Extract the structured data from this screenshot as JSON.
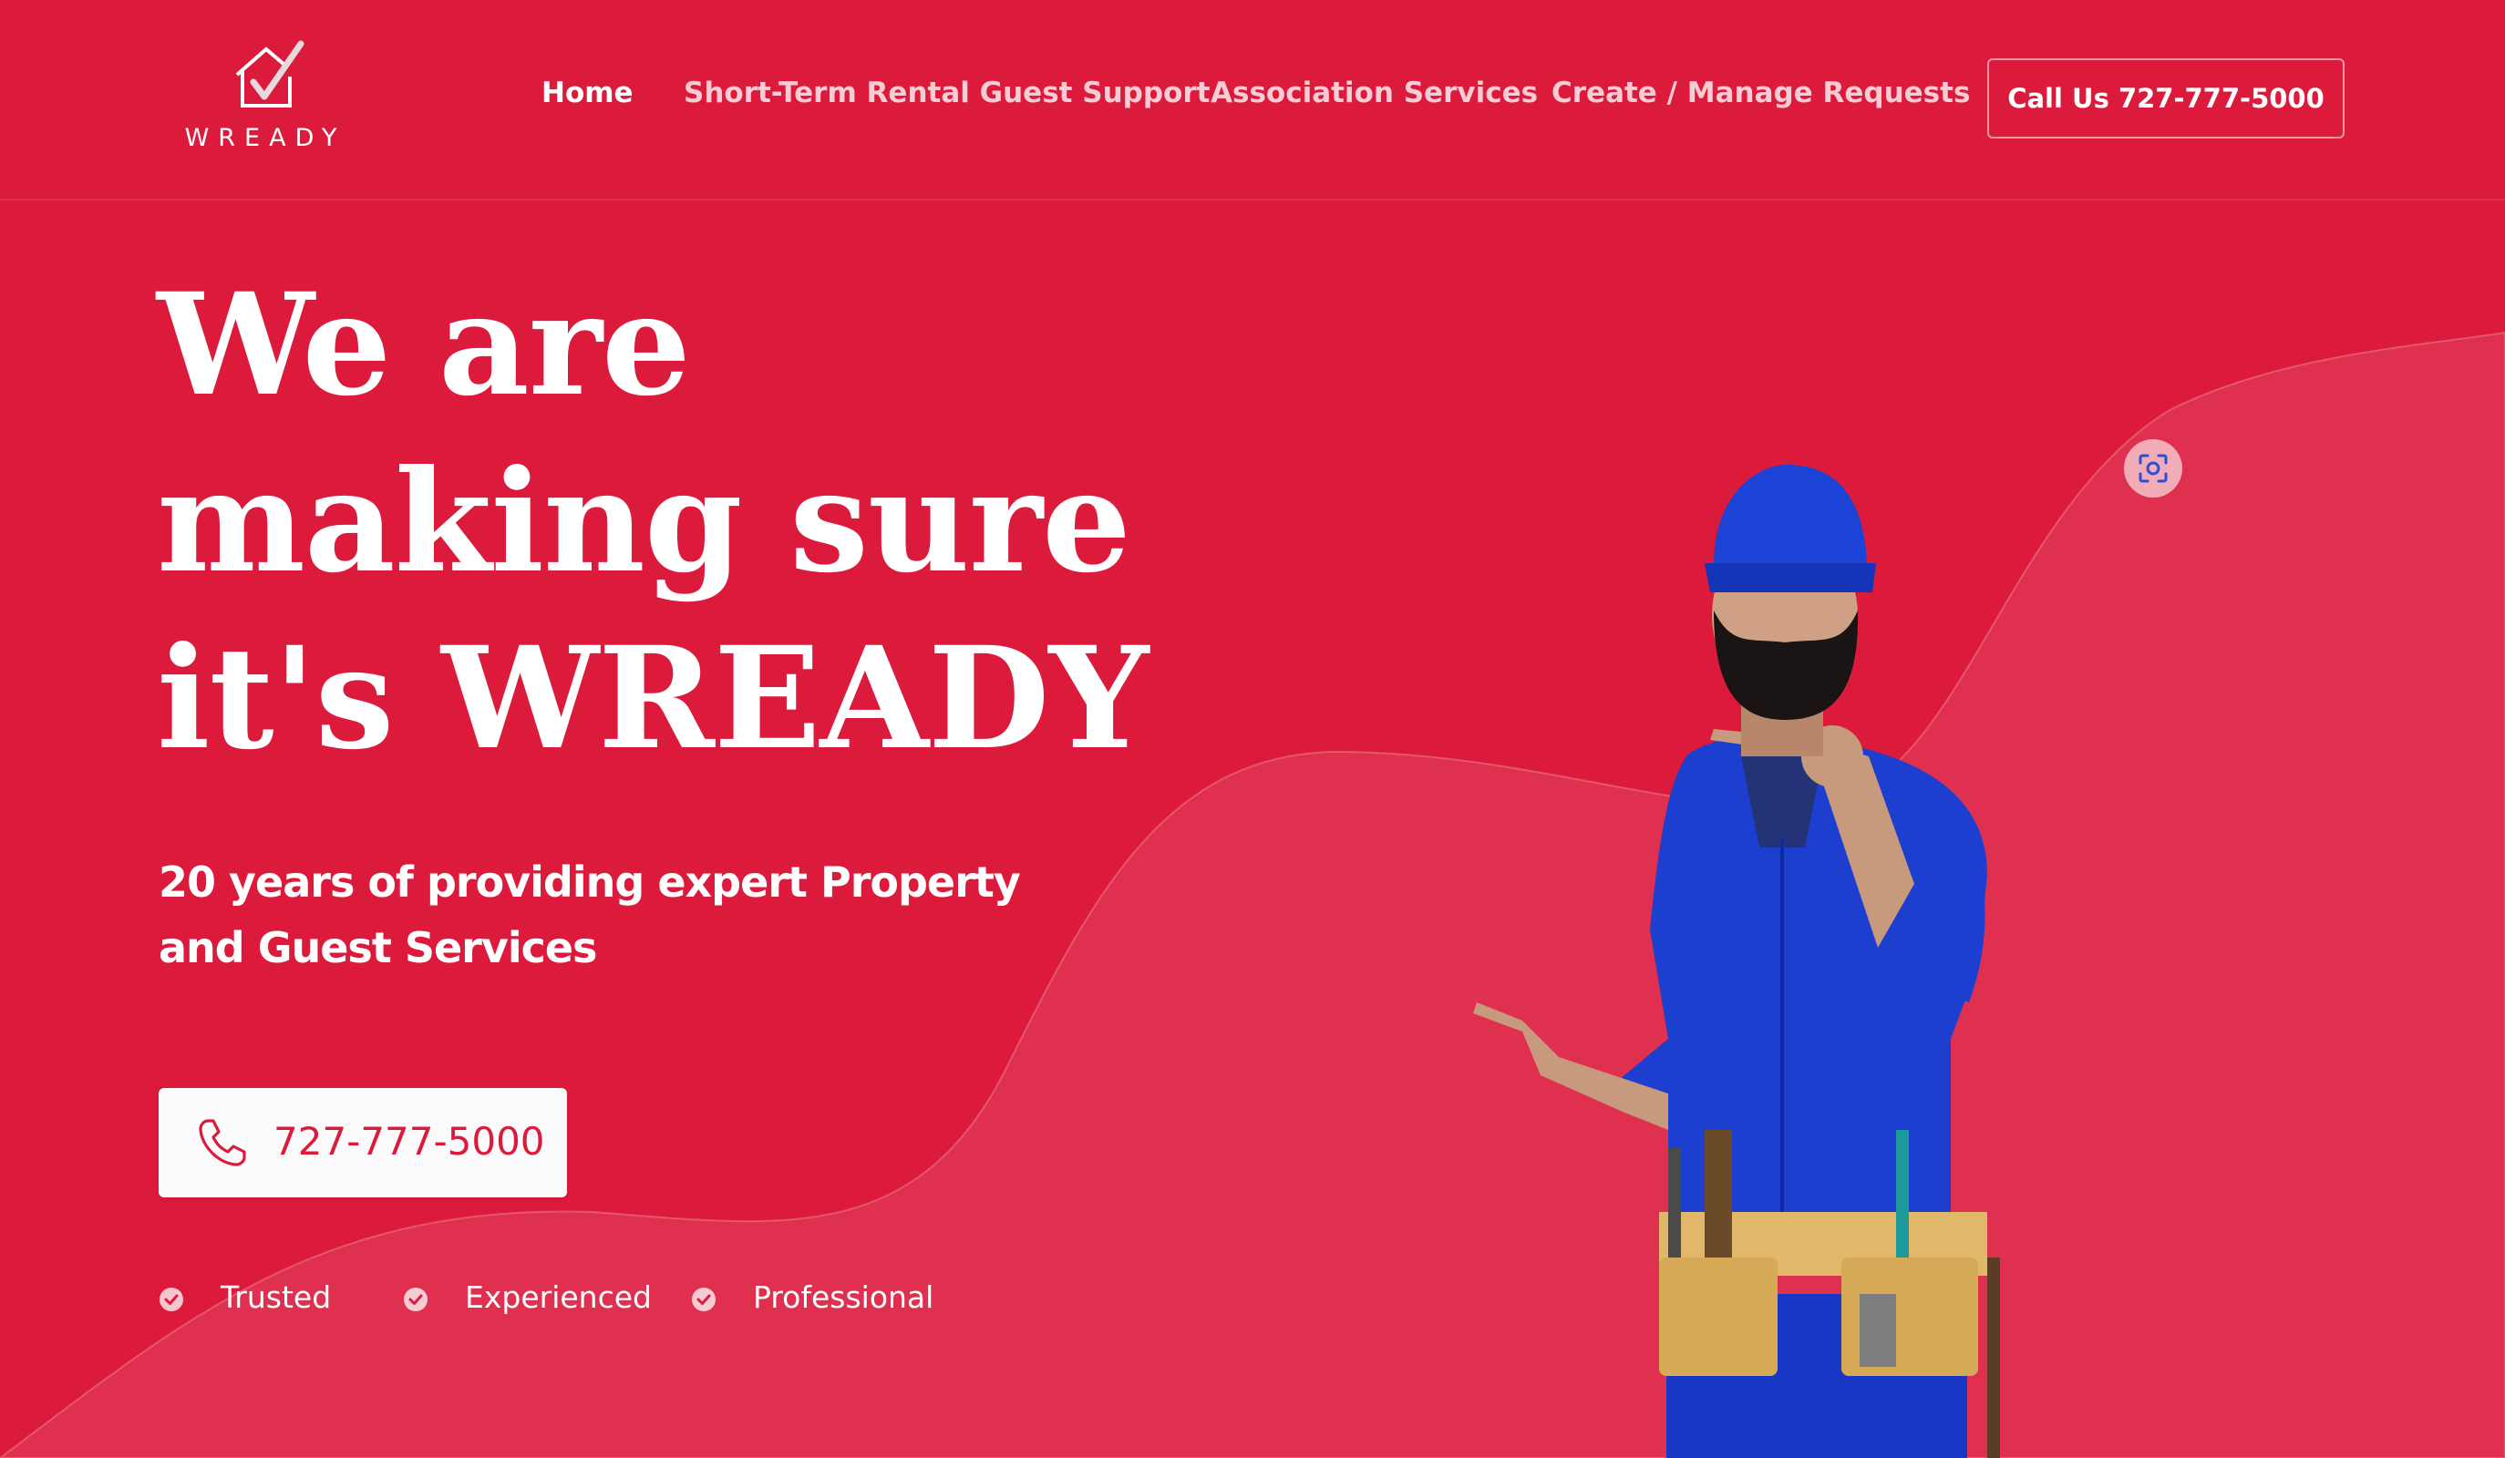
{
  "brand": {
    "name": "WREADY",
    "primary_color": "#dc1a3b",
    "text_color": "#ffffff"
  },
  "header": {
    "logo_icon": "house-check-icon",
    "nav": [
      {
        "label": "Home",
        "active": true
      },
      {
        "label": "Short-Term Rental Guest Support",
        "active": false
      },
      {
        "label": "Association Services",
        "active": false
      },
      {
        "label": "Create / Manage Requests",
        "active": false
      }
    ],
    "cta_label": "Call Us 727-777-5000"
  },
  "hero": {
    "title_lines": [
      "We are",
      "making sure",
      "it's WREADY"
    ],
    "subtitle_lines": [
      "20 years of providing expert Property",
      "and Guest Services"
    ],
    "phone_icon": "phone-icon",
    "phone_label": "727-777-5000",
    "features": [
      {
        "label": "Trusted",
        "icon": "check-circle-icon"
      },
      {
        "label": "Experienced",
        "icon": "check-circle-icon"
      },
      {
        "label": "Professional",
        "icon": "check-circle-icon"
      }
    ]
  },
  "image": {
    "subject": "worker-pointing-image",
    "scan_icon": "visual-search-icon"
  }
}
